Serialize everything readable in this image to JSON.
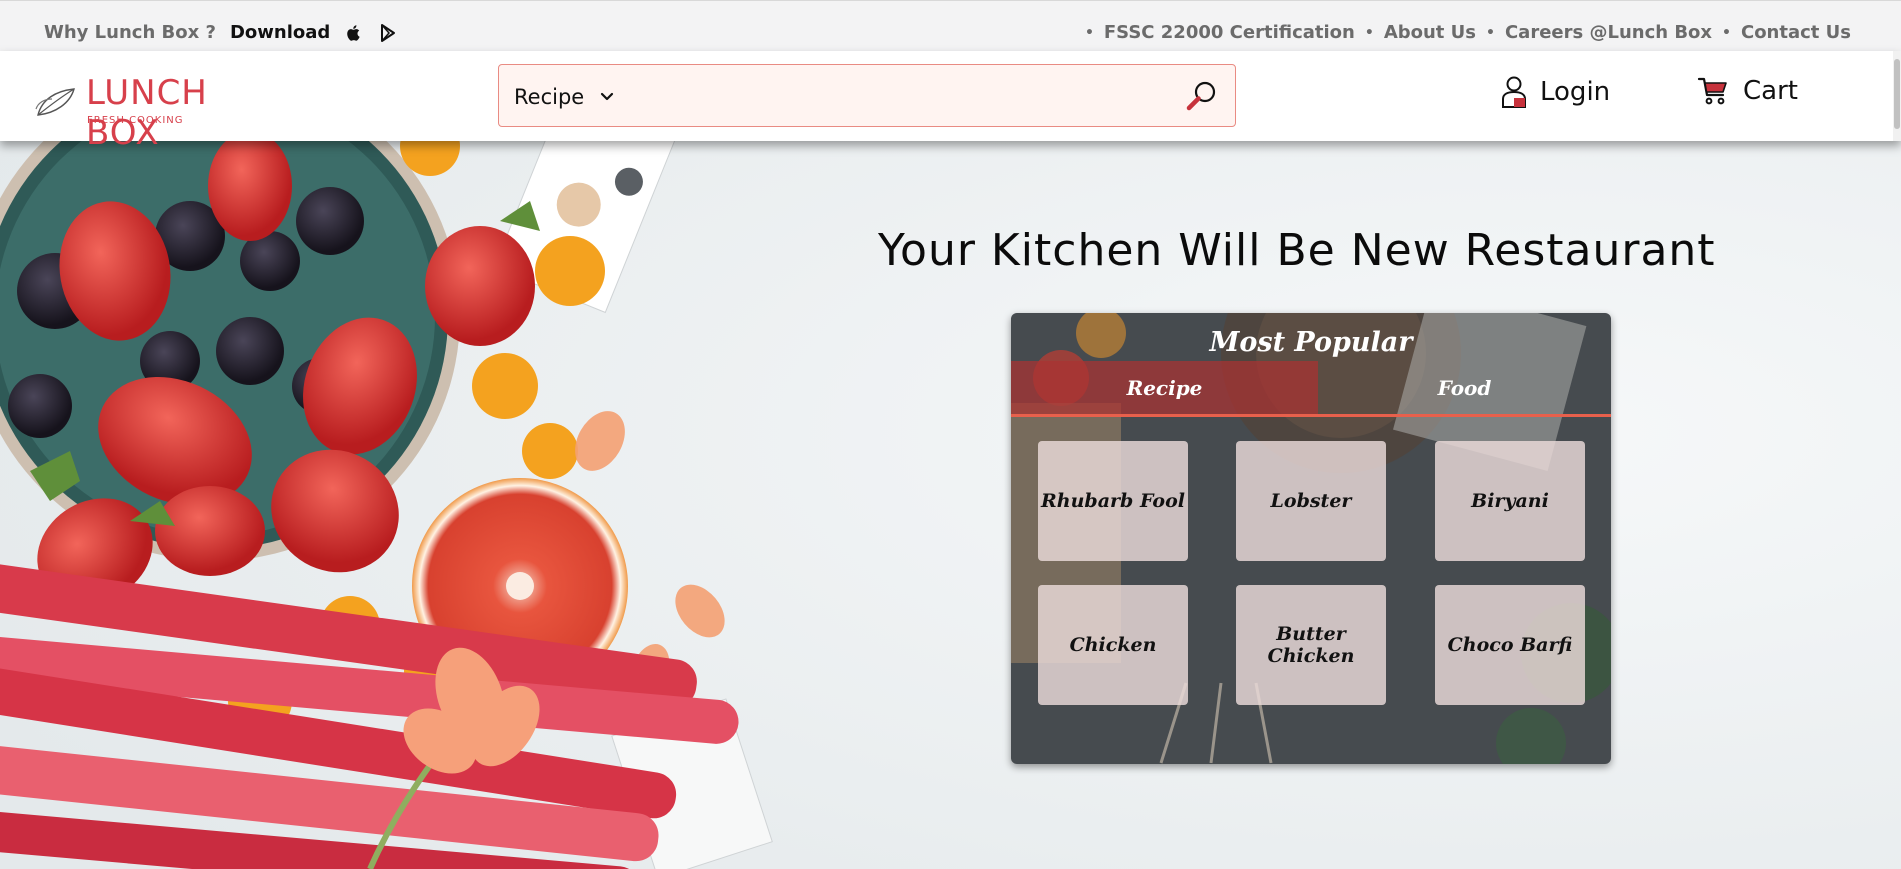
{
  "topbar": {
    "why": "Why Lunch Box ?",
    "download": "Download",
    "links": [
      "FSSC 22000 Certification",
      "About Us",
      "Careers @Lunch Box",
      "Contact Us"
    ],
    "bullet": "•"
  },
  "header": {
    "brand": "LUNCH BOX",
    "tagline": "FRESH COOKING",
    "search": {
      "category": "Recipe"
    },
    "login": "Login",
    "cart": "Cart"
  },
  "hero": {
    "headline": "Your Kitchen Will Be New Restaurant",
    "popular": {
      "title": "Most Popular",
      "tabs": [
        "Recipe",
        "Food"
      ],
      "active_tab": "Recipe",
      "items": [
        "Rhubarb Fool",
        "Lobster",
        "Biryani",
        "Chicken",
        "Butter Chicken",
        "Choco Barfi"
      ]
    }
  },
  "colors": {
    "accent": "#d7404b",
    "tab_underline": "#e8604c",
    "search_bg": "#fff4f1"
  }
}
